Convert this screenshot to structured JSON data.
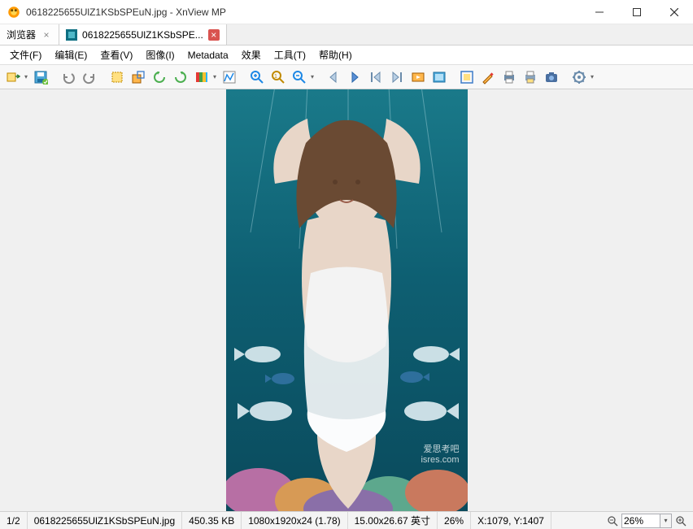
{
  "window": {
    "title": "0618225655UlZ1KSbSPEuN.jpg - XnView MP"
  },
  "tabs": {
    "browser_label": "浏览器",
    "image_label": "0618225655UlZ1KSbSPE..."
  },
  "menus": {
    "file": "文件(F)",
    "edit": "编辑(E)",
    "view": "查看(V)",
    "image": "图像(I)",
    "metadata": "Metadata",
    "effects": "效果",
    "tools": "工具(T)",
    "help": "帮助(H)"
  },
  "status": {
    "index": "1/2",
    "filename": "0618225655UlZ1KSbSPEuN.jpg",
    "filesize": "450.35 KB",
    "dimensions": "1080x1920x24 (1.78)",
    "physical": "15.00x26.67 英寸",
    "zoom": "26%",
    "coords": "X:1079, Y:1407",
    "zoom_input": "26%"
  },
  "watermark": {
    "line1": "爱思考吧",
    "line2": "isres.com"
  }
}
